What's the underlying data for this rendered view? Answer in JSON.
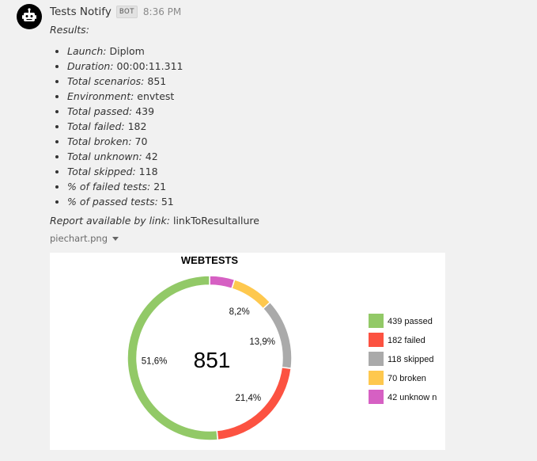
{
  "message": {
    "sender": "Tests Notify",
    "badge": "BOT",
    "time": "8:36 PM",
    "title": "Results:",
    "stats": [
      {
        "key": "Launch:",
        "value": "Diplom"
      },
      {
        "key": "Duration:",
        "value": "00:00:11.311"
      },
      {
        "key": "Total scenarios:",
        "value": "851"
      },
      {
        "key": "Environment:",
        "value": "envtest"
      },
      {
        "key": "Total passed:",
        "value": "439"
      },
      {
        "key": "Total failed:",
        "value": "182"
      },
      {
        "key": "Total broken:",
        "value": "70"
      },
      {
        "key": "Total unknown:",
        "value": "42"
      },
      {
        "key": "Total skipped:",
        "value": "118"
      },
      {
        "key": "% of failed tests:",
        "value": "21"
      },
      {
        "key": "% of passed tests:",
        "value": "51"
      }
    ],
    "report_key": "Report available by link:",
    "report_value": "linkToResultallure",
    "attachment_name": "piechart.png"
  },
  "icons": {
    "avatar": "robot-icon",
    "dropdown": "caret-down-icon"
  },
  "chart_data": {
    "type": "pie",
    "title": "WEBTESTS",
    "center_label": "851",
    "slices": [
      {
        "label": "439 passed",
        "value": 439,
        "pct_label": "51,6%",
        "color": "#92c967"
      },
      {
        "label": "182 failed",
        "value": 182,
        "pct_label": "21,4%",
        "color": "#fc5241"
      },
      {
        "label": "118 skipped",
        "value": 118,
        "pct_label": "13,9%",
        "color": "#aaaaaa"
      },
      {
        "label": "70 broken",
        "value": 70,
        "pct_label": "8,2%",
        "color": "#fec84e"
      },
      {
        "label": "42 unknow n",
        "value": 42,
        "pct_label": "",
        "color": "#d660c3"
      }
    ],
    "legend_position": "right"
  }
}
